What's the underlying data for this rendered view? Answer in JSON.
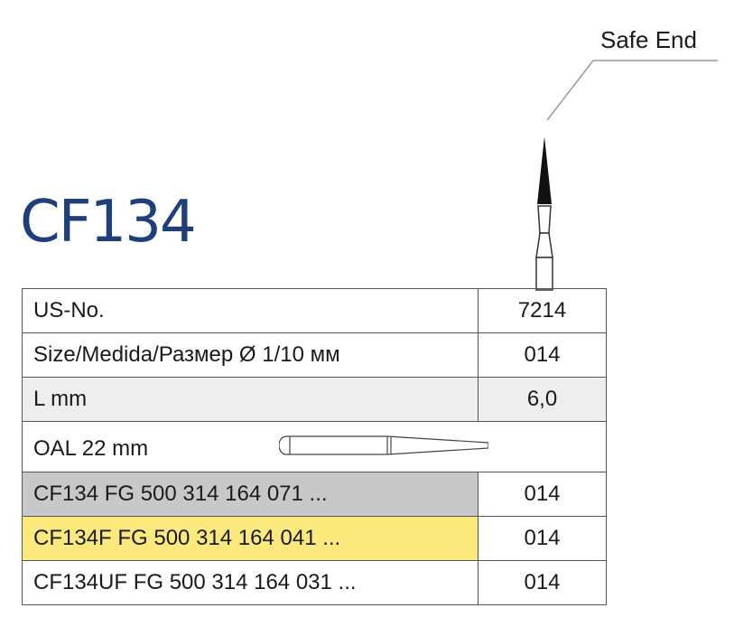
{
  "title": "CF134",
  "callout": {
    "label": "Safe End"
  },
  "colors": {
    "title": "#1f3f7a",
    "gray_row": "#c8c8c8",
    "yellow_row": "#fbe97e",
    "light_row": "#eeeeee"
  },
  "icons": [
    "bur-profile-icon",
    "shank-outline-icon"
  ],
  "table": {
    "rows": [
      {
        "label": "US-No.",
        "value": "7214"
      },
      {
        "label": "Size/Medida/Размер Ø 1/10 мм",
        "value": "014"
      },
      {
        "label": "L mm",
        "value": "6,0"
      },
      {
        "label": "OAL  22 mm",
        "value": ""
      },
      {
        "label": "CF134 FG 500 314 164 071 ...",
        "value": "014"
      },
      {
        "label": "CF134F FG 500 314 164 041 ...",
        "value": "014"
      },
      {
        "label": "CF134UF FG 500 314 164 031 ...",
        "value": "014"
      }
    ]
  }
}
